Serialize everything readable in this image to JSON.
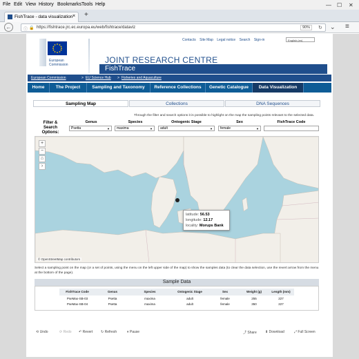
{
  "browser": {
    "menu": [
      "File",
      "Edit",
      "View",
      "History",
      "Bookmarks",
      "Tools",
      "Help"
    ],
    "tab_title": "FishTrace - data visualization",
    "new_tab": "+",
    "url": "https://fishtrace.jrc.ec.europa.eu/web/fishtrace/dataviz",
    "zoom": "90%"
  },
  "header": {
    "toplinks": [
      "Contacts",
      "Site Map",
      "Legal notice",
      "Search",
      "Sign-in"
    ],
    "lang": "English (en)",
    "logo_caption_1": "European",
    "logo_caption_2": "Commission",
    "jrc": "JOINT RESEARCH CENTRE",
    "site": "FishTrace",
    "breadcrumb": [
      "European Commission",
      "EU Science Hub",
      "Fisheries and Aquaculture"
    ],
    "breadcrumb_sep": ">"
  },
  "nav": {
    "items": [
      "Home",
      "The Project",
      "Sampling and Taxonomy",
      "Reference Collections",
      "Genetic Catalogue",
      "Data Visualization"
    ]
  },
  "subtabs": [
    "Sampling Map",
    "Collections",
    "DNA Sequences"
  ],
  "intro": "Through the filter and search options it is possible to highlight on the map the sampling points relevant to the selected data.",
  "filters": {
    "label_1": "Filter &",
    "label_2": "Search Options:",
    "cols": [
      "Genus",
      "Species",
      "Ontogenic Stage",
      "Sex",
      "FishTrace Code"
    ],
    "values": [
      "Psetta",
      "maxima",
      "adult",
      "female",
      ""
    ]
  },
  "map": {
    "popup": {
      "lat_label": "latitude:",
      "lat": "56.53",
      "lon_label": "longitude:",
      "lon": "12.17",
      "loc_label": "locality:",
      "loc": "Morups Bank"
    },
    "attribution": "© OpenStreetMap contributors",
    "controls": [
      "+",
      "−",
      "⌂",
      "›"
    ]
  },
  "instructions": "Select a sampling point on the map (or a set of points, using the menu on the left upper side of the map) to show the samples data (to clear the data selection, use the revert arrow from the menu at the bottom of the page).",
  "table": {
    "title": "Sample Data",
    "headers": [
      "FishTrace Code",
      "Genus",
      "Species",
      "Ontogenic Stage",
      "Sex",
      "Weight (g)",
      "Length (mm)"
    ],
    "rows": [
      [
        "PseMax-SB-03",
        "Psetta",
        "maxima",
        "adult",
        "female",
        "255",
        "227"
      ],
      [
        "PseMax-SB-04",
        "Psetta",
        "maxima",
        "adult",
        "female",
        "350",
        "227"
      ]
    ]
  },
  "toolbar": {
    "undo": "Undo",
    "redo": "Redo",
    "revert": "Revert",
    "refresh": "Refresh",
    "pause": "Pause",
    "share": "Share",
    "download": "Download",
    "fullscreen": "Full Screen"
  }
}
